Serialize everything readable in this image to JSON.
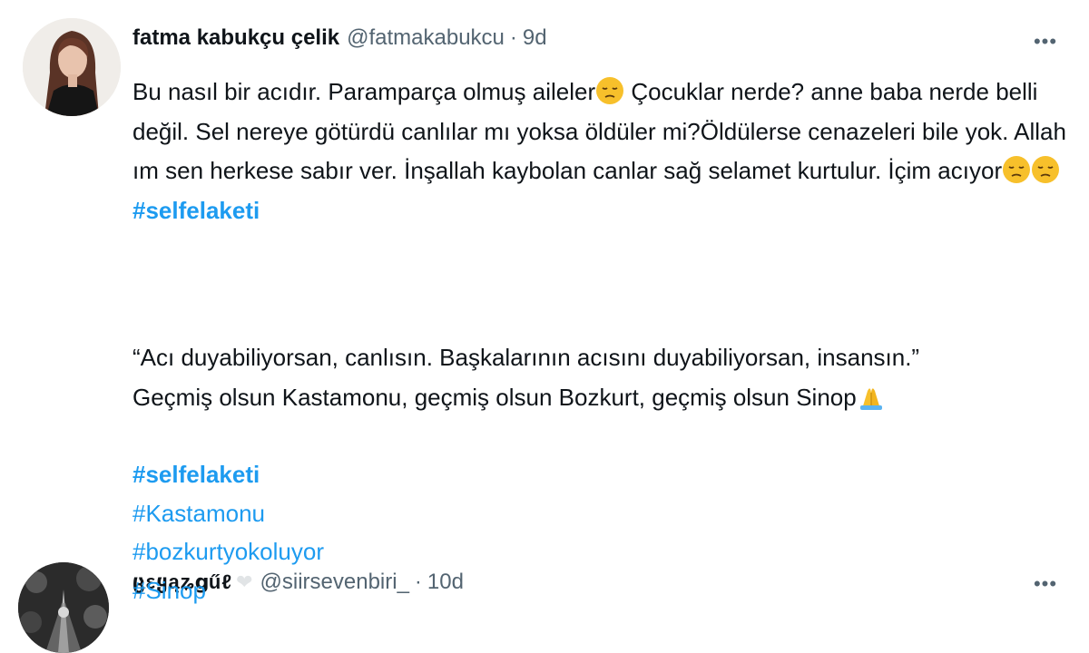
{
  "tweet1": {
    "display_name": "fatma kabukçu çelik",
    "handle": "@fatmakabukcu",
    "separator": "·",
    "time": "9d",
    "more": "•••",
    "text_part1": "Bu nasıl bir acıdır. Paramparça olmuş aileler",
    "text_part2": " Çocuklar nerde? anne baba nerde belli değil. Sel nereye götürdü canlılar mı yoksa öldüler mi?Öldülerse cenazeleri bile yok. Allah ım sen herkese sabır ver. İnşallah kaybolan canlar sağ selamet kurtulur. İçim acıyor",
    "hashtag": "#selfelaketi",
    "emoji_icon": "pensive-face-icon"
  },
  "tweet2": {
    "display_name": "ცεყąʑցűℓ",
    "handle": "@siirsevenbiri_",
    "separator": "·",
    "time": "10d",
    "more": "•••",
    "heart_icon": "white-heart-icon",
    "line1": "“Acı duyabiliyorsan, canlısın. Başkalarının acısını duyabiliyorsan, insansın.”",
    "line2": "Geçmiş olsun Kastamonu, geçmiş olsun Bozkurt, geçmiş olsun Sinop",
    "emoji_icon": "folded-hands-icon",
    "hashtags": [
      "#selfelaketi",
      "#Kastamonu",
      "#bozkurtyokoluyor",
      "#Sinop"
    ]
  },
  "colors": {
    "text": "#0f1419",
    "muted": "#536471",
    "link": "#1d9bf0",
    "emoji": "#f7c02b"
  }
}
